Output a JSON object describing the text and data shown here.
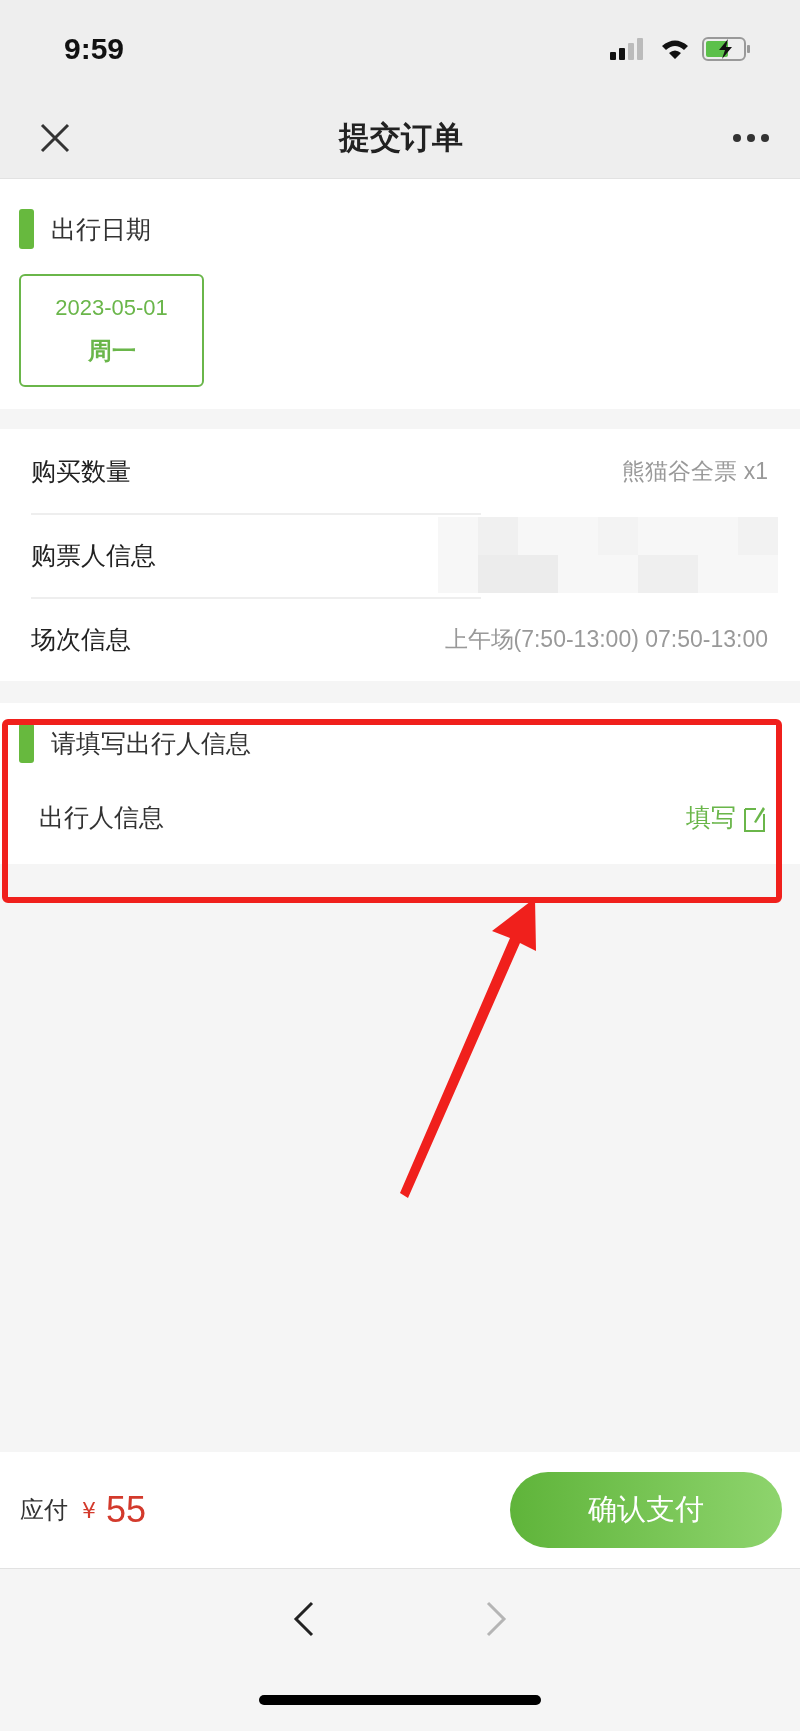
{
  "status_bar": {
    "time": "9:59"
  },
  "nav": {
    "title": "提交订单"
  },
  "date_section": {
    "heading": "出行日期",
    "dates": [
      {
        "date": "2023-05-01",
        "weekday": "周一",
        "selected": true
      }
    ]
  },
  "info_rows": [
    {
      "label": "购买数量",
      "value": "熊猫谷全票 x1",
      "kind": "text"
    },
    {
      "label": "购票人信息",
      "kind": "redacted"
    },
    {
      "label": "场次信息",
      "value": "上午场(7:50-13:00) 07:50-13:00",
      "kind": "text"
    }
  ],
  "traveler_section": {
    "heading": "请填写出行人信息",
    "label": "出行人信息",
    "action": "填写",
    "highlighted": true
  },
  "footer": {
    "label": "应付",
    "currency": "¥",
    "amount": "55",
    "button": "确认支付"
  },
  "browser_nav": [
    {
      "kind": "back",
      "disabled": false
    },
    {
      "kind": "forward",
      "disabled": true
    }
  ]
}
